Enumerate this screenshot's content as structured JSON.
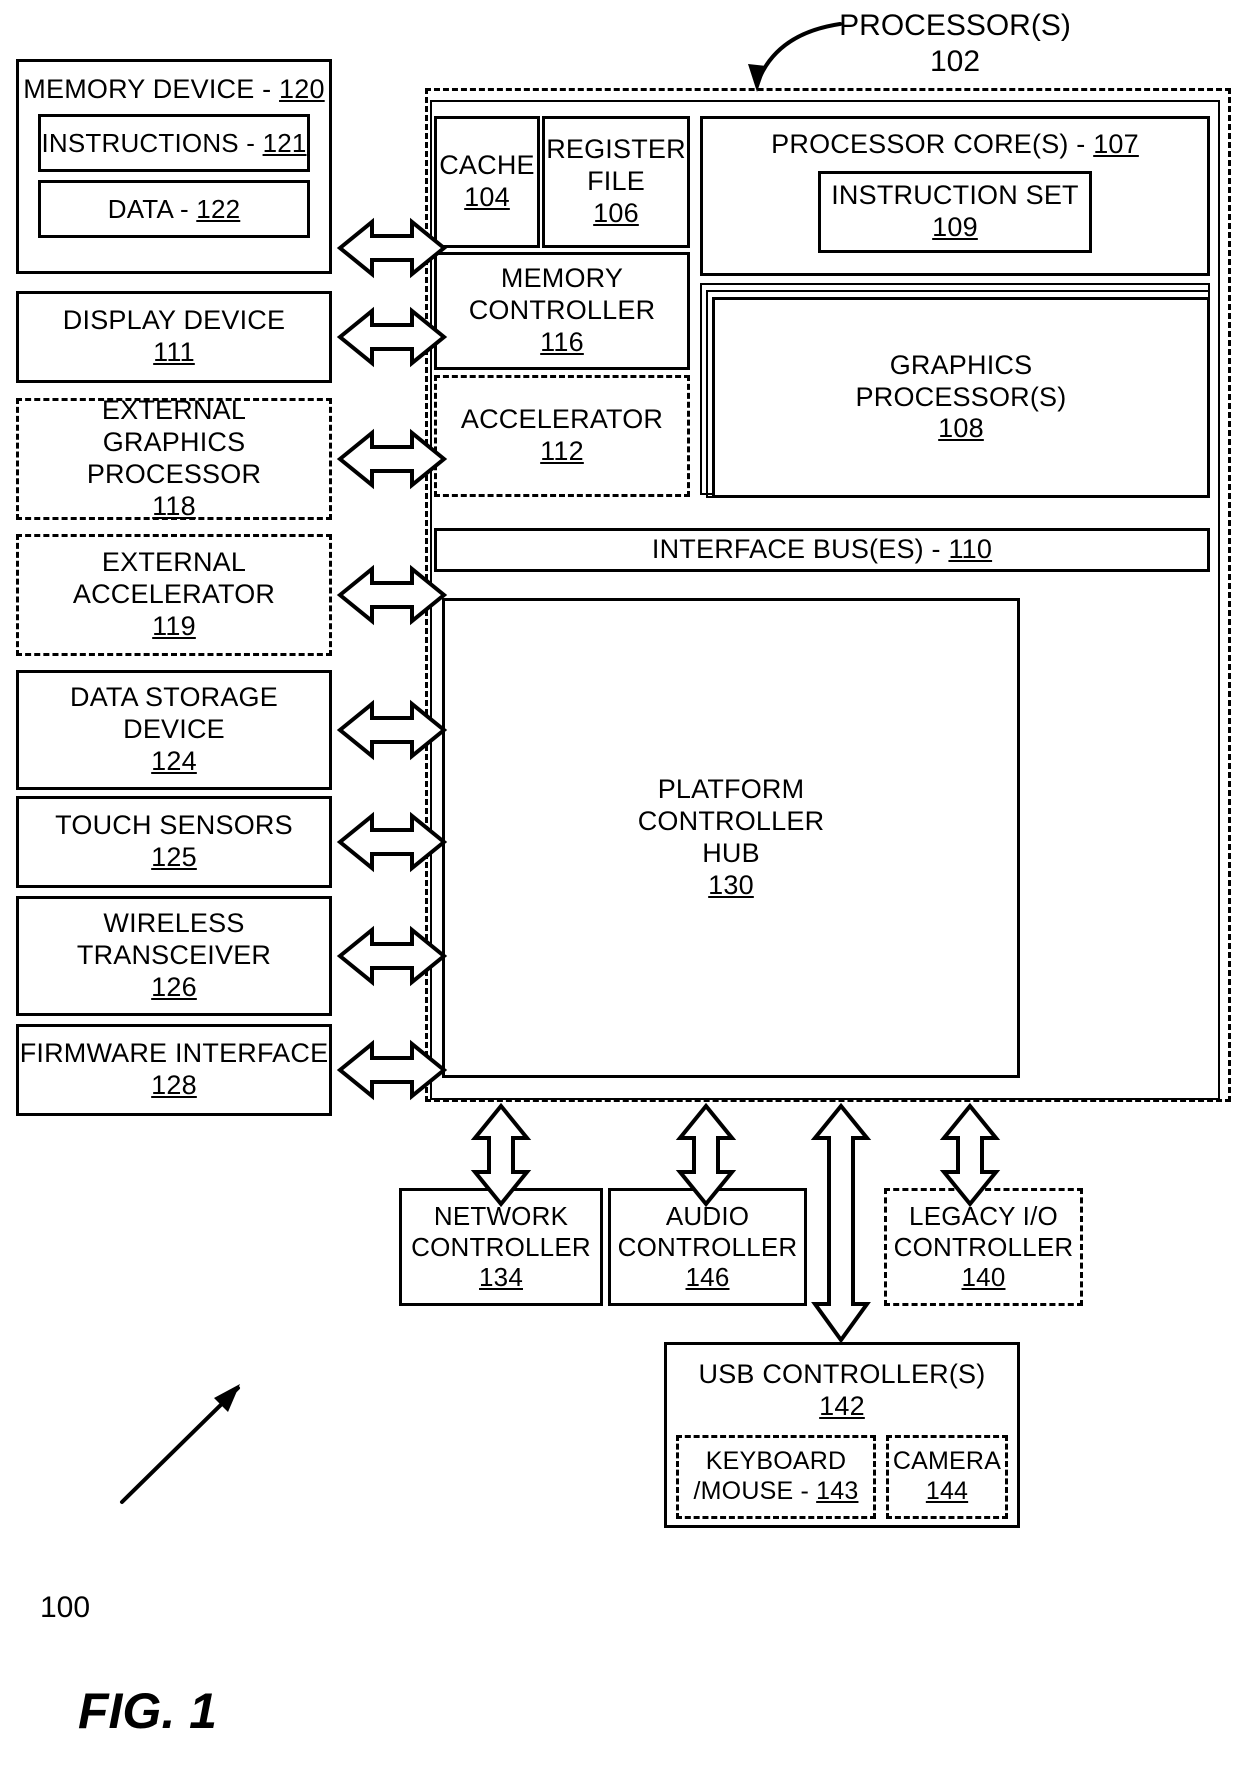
{
  "figure": {
    "caption": "FIG. 1",
    "system_ref": "100",
    "callout_label": "PROCESSOR(S)",
    "callout_ref": "102"
  },
  "left_column": {
    "memory_device": {
      "label": "MEMORY DEVICE - ",
      "ref": "120",
      "children": [
        {
          "label": "INSTRUCTIONS - ",
          "ref": "121"
        },
        {
          "label": "DATA - ",
          "ref": "122"
        }
      ]
    },
    "items": [
      {
        "name": "display-device",
        "lines": [
          "DISPLAY DEVICE"
        ],
        "ref": "111",
        "style": "solid"
      },
      {
        "name": "external-graphics-processor",
        "lines": [
          "EXTERNAL",
          "GRAPHICS PROCESSOR"
        ],
        "ref": "118",
        "style": "dashed"
      },
      {
        "name": "external-accelerator",
        "lines": [
          "EXTERNAL",
          "ACCELERATOR"
        ],
        "ref": "119",
        "style": "dashed"
      },
      {
        "name": "data-storage-device",
        "lines": [
          "DATA STORAGE",
          "DEVICE"
        ],
        "ref": "124",
        "style": "solid"
      },
      {
        "name": "touch-sensors",
        "lines": [
          "TOUCH SENSORS"
        ],
        "ref": "125",
        "style": "solid"
      },
      {
        "name": "wireless-transceiver",
        "lines": [
          "WIRELESS",
          "TRANSCEIVER"
        ],
        "ref": "126",
        "style": "solid"
      },
      {
        "name": "firmware-interface",
        "lines": [
          "FIRMWARE INTERFACE"
        ],
        "ref": "128",
        "style": "solid"
      }
    ]
  },
  "processor": {
    "cache": {
      "label": "CACHE",
      "ref": "104"
    },
    "register_file": {
      "lines": [
        "REGISTER",
        "FILE"
      ],
      "ref": "106"
    },
    "memory_controller": {
      "lines": [
        "MEMORY",
        "CONTROLLER"
      ],
      "ref": "116"
    },
    "accelerator": {
      "label": "ACCELERATOR",
      "ref": "112"
    },
    "processor_cores": {
      "label": "PROCESSOR CORE(S) - ",
      "ref": "107"
    },
    "instruction_set": {
      "label": "INSTRUCTION SET",
      "ref": "109"
    },
    "graphics_processors": {
      "lines": [
        "GRAPHICS",
        "PROCESSOR(S)"
      ],
      "ref": "108"
    },
    "interface_bus": {
      "label": "INTERFACE BUS(ES) - ",
      "ref": "110"
    }
  },
  "platform_controller_hub": {
    "lines": [
      "PLATFORM",
      "CONTROLLER",
      "HUB"
    ],
    "ref": "130"
  },
  "peripherals": [
    {
      "name": "network-controller",
      "lines": [
        "NETWORK",
        "CONTROLLER"
      ],
      "ref": "134",
      "style": "solid"
    },
    {
      "name": "audio-controller",
      "lines": [
        "AUDIO",
        "CONTROLLER"
      ],
      "ref": "146",
      "style": "solid"
    },
    {
      "name": "legacy-io-controller",
      "lines": [
        "LEGACY I/O",
        "CONTROLLER"
      ],
      "ref": "140",
      "style": "dashed"
    }
  ],
  "usb": {
    "label": "USB CONTROLLER(S)",
    "ref": "142",
    "devices": [
      {
        "name": "keyboard-mouse",
        "lines": [
          "KEYBOARD",
          "/MOUSE - "
        ],
        "ref": "143",
        "inline_ref": true
      },
      {
        "name": "camera",
        "lines": [
          "CAMERA"
        ],
        "ref": "144",
        "inline_ref": false
      }
    ]
  }
}
